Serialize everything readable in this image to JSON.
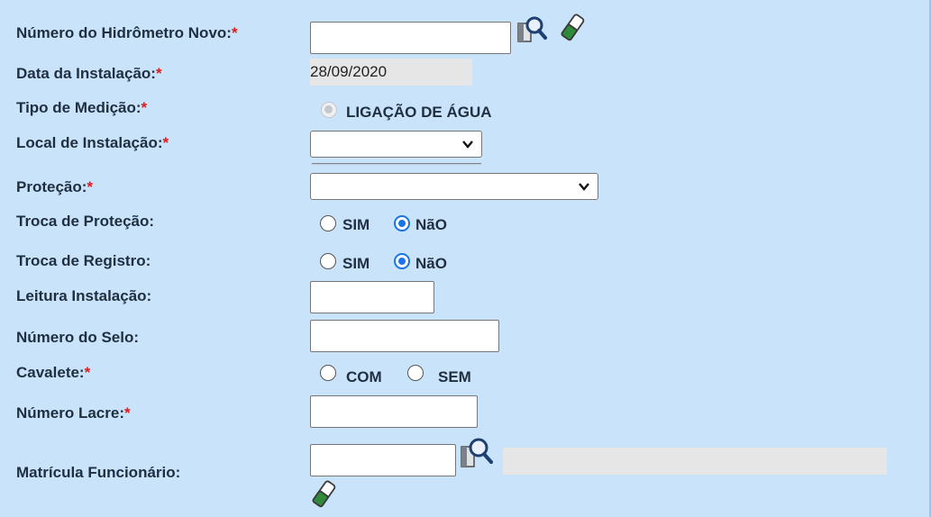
{
  "form": {
    "required_mark": "*",
    "hidrometro": {
      "label": "Número do Hidrômetro Novo:",
      "value": ""
    },
    "data_instalacao": {
      "label": "Data da Instalação:",
      "value": "28/09/2020"
    },
    "tipo_medicao": {
      "label": "Tipo de Medição:",
      "option": "LIGAÇÃO DE ÁGUA"
    },
    "local_instalacao": {
      "label": "Local de Instalação:",
      "selected": ""
    },
    "protecao": {
      "label": "Proteção:",
      "selected": ""
    },
    "troca_protecao": {
      "label": "Troca de Proteção:",
      "option_sim": "SIM",
      "option_nao": "NãO",
      "selected": "NãO"
    },
    "troca_registro": {
      "label": "Troca de Registro:",
      "option_sim": "SIM",
      "option_nao": "NãO",
      "selected": "NãO"
    },
    "leitura_instalacao": {
      "label": "Leitura Instalação:",
      "value": ""
    },
    "numero_selo": {
      "label": "Número do Selo:",
      "value": ""
    },
    "cavalete": {
      "label": "Cavalete:",
      "option_com": "COM",
      "option_sem": "SEM",
      "selected": ""
    },
    "numero_lacre": {
      "label": "Número Lacre:",
      "value": ""
    },
    "matricula": {
      "label": "Matrícula Funcionário:",
      "value": "",
      "name_value": ""
    }
  },
  "icons": [
    "search-icon",
    "eraser-icon"
  ],
  "colors": {
    "background": "#c9e3fb",
    "required": "#e01a1a",
    "radio_selected": "#1a73e8"
  }
}
